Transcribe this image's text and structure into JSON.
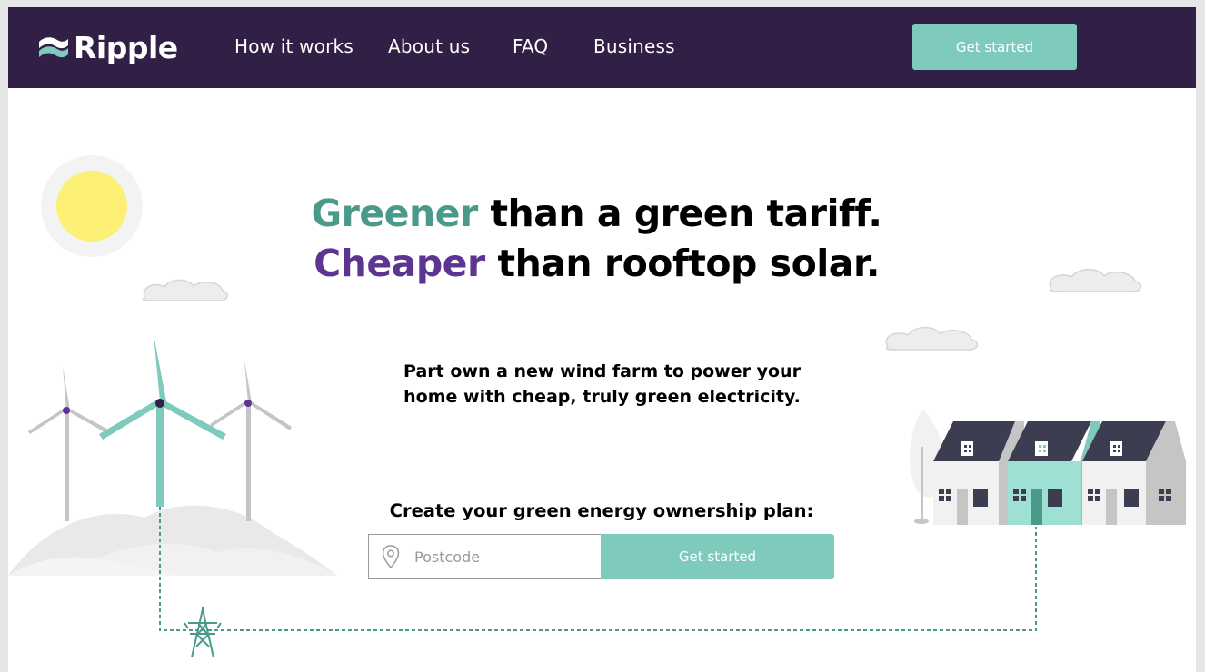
{
  "brand": {
    "name": "Ripple",
    "colors": {
      "nav_bg": "#311f45",
      "teal": "#7ecabd",
      "green_accent": "#4a9a8b",
      "purple_accent": "#5b3590"
    }
  },
  "nav": {
    "links": [
      "How it works",
      "About us",
      "FAQ",
      "Business"
    ],
    "cta_label": "Get started"
  },
  "hero": {
    "headline_line1_accent": "Greener",
    "headline_line1_rest": " than a green tariff.",
    "headline_line2_accent": "Cheaper",
    "headline_line2_rest": " than rooftop solar.",
    "subhead_line1": "Part own a new wind farm to power your",
    "subhead_line2": "home with cheap, truly green electricity."
  },
  "plan_form": {
    "label": "Create your green energy ownership plan:",
    "postcode_placeholder": "Postcode",
    "submit_label": "Get started",
    "icon": "location-pin-icon"
  },
  "illustration": {
    "icons": [
      "sun-icon",
      "cloud-icon",
      "wind-turbine-icon",
      "pylon-icon",
      "terraced-houses-icon",
      "tree-icon"
    ]
  }
}
